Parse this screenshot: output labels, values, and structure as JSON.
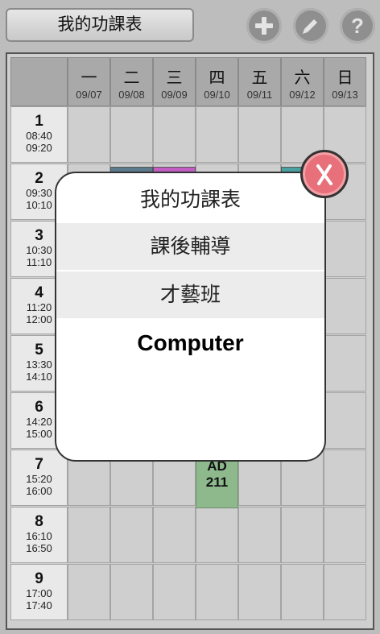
{
  "toolbar": {
    "title": "我的功課表",
    "add_icon": "plus-icon",
    "edit_icon": "pencil-icon",
    "help_label": "?"
  },
  "days": [
    {
      "name": "一",
      "date": "09/07"
    },
    {
      "name": "二",
      "date": "09/08"
    },
    {
      "name": "三",
      "date": "09/09"
    },
    {
      "name": "四",
      "date": "09/10"
    },
    {
      "name": "五",
      "date": "09/11"
    },
    {
      "name": "六",
      "date": "09/12"
    },
    {
      "name": "日",
      "date": "09/13"
    }
  ],
  "periods": [
    {
      "num": "1",
      "start": "08:40",
      "end": "09:20"
    },
    {
      "num": "2",
      "start": "09:30",
      "end": "10:10"
    },
    {
      "num": "3",
      "start": "10:30",
      "end": "11:10"
    },
    {
      "num": "4",
      "start": "11:20",
      "end": "12:00"
    },
    {
      "num": "5",
      "start": "13:30",
      "end": "14:10"
    },
    {
      "num": "6",
      "start": "14:20",
      "end": "15:00"
    },
    {
      "num": "7",
      "start": "15:20",
      "end": "16:00"
    },
    {
      "num": "8",
      "start": "16:10",
      "end": "16:50"
    },
    {
      "num": "9",
      "start": "17:00",
      "end": "17:40"
    }
  ],
  "course": {
    "name": "AD",
    "room": "211",
    "day": "四",
    "period": "7",
    "color": "#8db98d"
  },
  "course_colors": {
    "period2_tue": "#5b7a8c",
    "period2_wed": "#c35cc3",
    "period2_sat": "#4aa0a0"
  },
  "popup": {
    "items": [
      {
        "label": "我的功課表"
      },
      {
        "label": "課後輔導"
      },
      {
        "label": "才藝班"
      },
      {
        "label": "Computer"
      }
    ],
    "selected": "Computer",
    "close_label": "X"
  }
}
